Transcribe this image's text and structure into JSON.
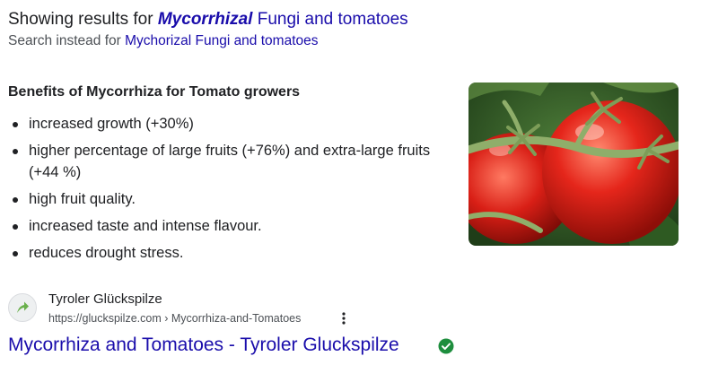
{
  "correction": {
    "prefix": "Showing results for",
    "corrected_term": "Mycorrhizal",
    "rest": "Fungi and tomatoes"
  },
  "search_instead": {
    "prefix": "Search instead for",
    "link": "Mychorizal Fungi and tomatoes"
  },
  "snippet": {
    "title": "Benefits of Mycorrhiza for Tomato growers",
    "items": [
      "increased growth (+30%)",
      "higher percentage of large fruits (+76%) and extra-large fruits (+44 %)",
      "high fruit quality.",
      "increased taste and intense flavour.",
      "reduces drought stress."
    ],
    "image_icon": "tomato-photo"
  },
  "result": {
    "site_name": "Tyroler Glückspilze",
    "url": "https://gluckspilze.com › Mycorrhiza-and-Tomatoes",
    "title": "Mycorrhiza and Tomatoes - Tyroler Gluckspilze",
    "site_icon": "arrow-favicon-icon",
    "menu_icon": "more-vert-icon",
    "verified_icon": "verified-check-icon"
  },
  "colors": {
    "link": "#1a0dab",
    "text": "#202124",
    "muted": "#4d5156",
    "verified": "#1e8e3e",
    "favicon": "#6ab04c"
  }
}
